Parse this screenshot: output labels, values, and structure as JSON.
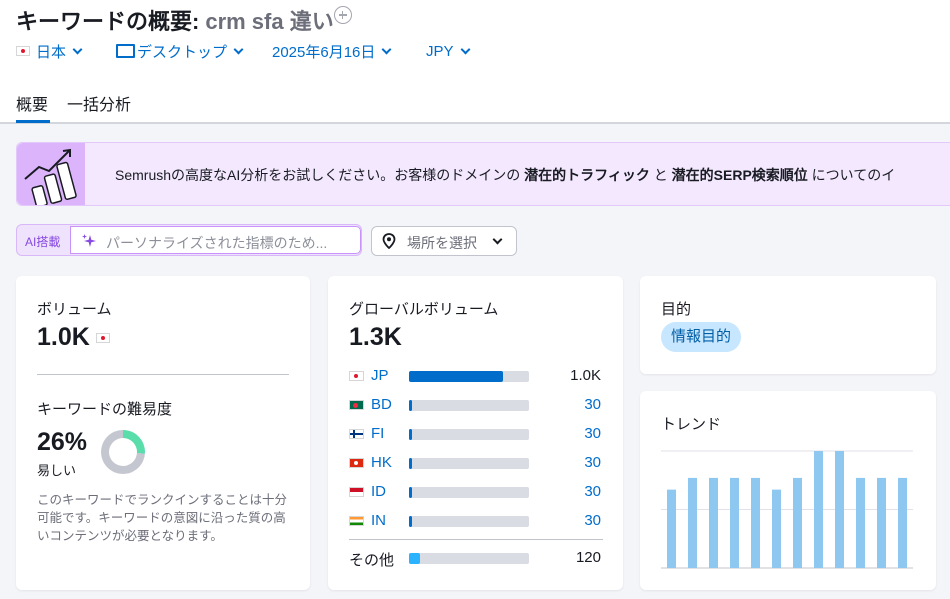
{
  "header": {
    "title": "キーワードの概要:",
    "keyword": "crm sfa 違い",
    "filters": {
      "country": "日本",
      "device": "デスクトップ",
      "date": "2025年6月16日",
      "currency": "JPY"
    },
    "tabs": [
      {
        "label": "概要",
        "active": true
      },
      {
        "label": "一括分析",
        "active": false
      }
    ]
  },
  "banner": {
    "text_1": "Semrushの高度なAI分析をお試しください。お客様のドメインの ",
    "bold_1": "潜在的トラフィック",
    "text_2": " と ",
    "bold_2": "潜在的SERP検索順位",
    "text_3": " についてのイ"
  },
  "ai_search": {
    "label": "AI搭載",
    "placeholder": "パーソナライズされた指標のため..."
  },
  "location": {
    "label": "場所を選択"
  },
  "volume_card": {
    "title": "ボリューム",
    "value": "1.0K",
    "difficulty_title": "キーワードの難易度",
    "difficulty_value": "26%",
    "difficulty_percent": 26,
    "difficulty_label": "易しい",
    "description": "このキーワードでランクインすることは十分可能です。キーワードの意図に沿った質の高いコンテンツが必要となります。"
  },
  "global_card": {
    "title": "グローバルボリューム",
    "value": "1.3K",
    "rows": [
      {
        "code": "JP",
        "value": "1.0K",
        "fill": 0.78
      },
      {
        "code": "BD",
        "value": "30",
        "fill": 0.025
      },
      {
        "code": "FI",
        "value": "30",
        "fill": 0.025
      },
      {
        "code": "HK",
        "value": "30",
        "fill": 0.025
      },
      {
        "code": "ID",
        "value": "30",
        "fill": 0.025
      },
      {
        "code": "IN",
        "value": "30",
        "fill": 0.025
      }
    ],
    "other": {
      "label": "その他",
      "value": "120",
      "fill": 0.09
    }
  },
  "intent_card": {
    "title": "目的",
    "badge": "情報目的"
  },
  "trend_card": {
    "title": "トレンド"
  },
  "chart_data": {
    "type": "bar",
    "title": "トレンド",
    "values": [
      0.67,
      0.77,
      0.77,
      0.77,
      0.77,
      0.67,
      0.77,
      1.0,
      1.0,
      0.77,
      0.77,
      0.77
    ],
    "ylim": [
      0,
      1
    ],
    "grid": true
  },
  "colors": {
    "accent": "#006dca",
    "trend_bar": "#8ec8f0",
    "difficulty": "#59ddaa",
    "badge_bg": "#c7e6ff",
    "banner_bg": "#f3e8fe"
  }
}
